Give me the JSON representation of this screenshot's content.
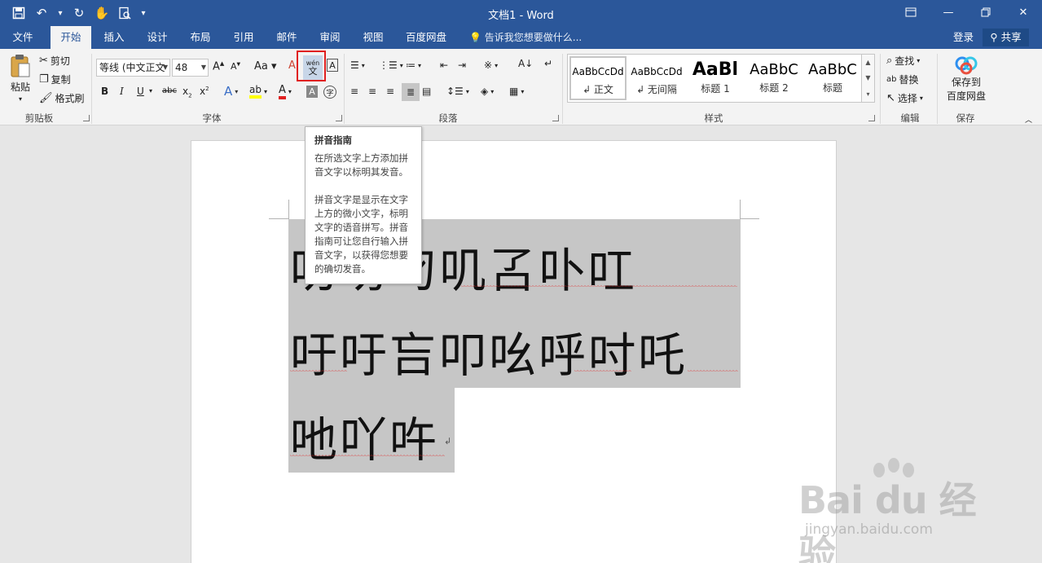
{
  "window": {
    "title": "文档1 - Word"
  },
  "tabs": [
    "文件",
    "开始",
    "插入",
    "设计",
    "布局",
    "引用",
    "邮件",
    "审阅",
    "视图",
    "百度网盘"
  ],
  "active_tab": "开始",
  "tell_me": "告诉我您想要做什么...",
  "account": {
    "login": "登录",
    "share": "共享"
  },
  "clipboard": {
    "paste": "粘贴",
    "cut": "剪切",
    "copy": "复制",
    "format_painter": "格式刷",
    "label": "剪贴板"
  },
  "font": {
    "name": "等线 (中文正文",
    "size": "48",
    "label": "字体",
    "pinyin_glyph_top": "wén",
    "pinyin_glyph_bottom": "文"
  },
  "paragraph": {
    "label": "段落"
  },
  "styles": {
    "label": "样式",
    "items": [
      {
        "sample": "AaBbCcDd",
        "name": "↲ 正文"
      },
      {
        "sample": "AaBbCcDd",
        "name": "↲ 无间隔"
      },
      {
        "sample": "AaBl",
        "name": "标题 1"
      },
      {
        "sample": "AaBbC",
        "name": "标题 2"
      },
      {
        "sample": "AaBbC",
        "name": "标题"
      }
    ]
  },
  "editing": {
    "find": "查找",
    "replace": "替换",
    "select": "选择",
    "label": "编辑"
  },
  "save": {
    "button_line1": "保存到",
    "button_line2": "百度网盘",
    "label": "保存"
  },
  "tooltip": {
    "title": "拼音指南",
    "para1": "在所选文字上方添加拼音文字以标明其发音。",
    "para2": "拼音文字是显示在文字上方的微小文字，标明文字的语音拼写。拼音指南可让您自行输入拼音文字，以获得您想要的确切发音。"
  },
  "document": {
    "line1": "叨叻叼叽叾卟叿",
    "line2": "吁吁吂叩吆呼吋吒",
    "line3": "吔吖吘"
  },
  "watermark": {
    "main": "Bai du 经验",
    "sub": "jingyan.baidu.com"
  }
}
